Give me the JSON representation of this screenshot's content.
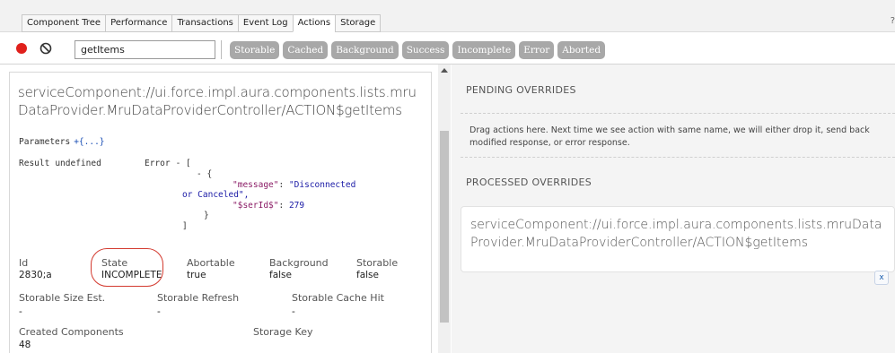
{
  "tabs": [
    {
      "label": "Component Tree"
    },
    {
      "label": "Performance"
    },
    {
      "label": "Transactions"
    },
    {
      "label": "Event Log"
    },
    {
      "label": "Actions"
    },
    {
      "label": "Storage"
    }
  ],
  "active_tab": "Actions",
  "tab_right_mark": "?",
  "toolbar": {
    "record_icon": "record-icon",
    "clear_icon": "clear-icon",
    "filter_value": "getItems",
    "filters": [
      {
        "label": "Storable"
      },
      {
        "label": "Cached"
      },
      {
        "label": "Background"
      },
      {
        "label": "Success"
      },
      {
        "label": "Incomplete"
      },
      {
        "label": "Error"
      },
      {
        "label": "Aborted"
      }
    ]
  },
  "action": {
    "title": "serviceComponent://ui.force.impl.aura.components.lists.mruDataProvider.MruDataProviderController/ACTION$getItems",
    "parameters_label": "Parameters",
    "parameters_value": "+{...}",
    "result_label": "Result",
    "result_value": "undefined",
    "error_label": "Error",
    "error_value": "- [",
    "error_json": {
      "obj_open": "- {",
      "message_key": "\"message\"",
      "message_value_1": "\"Disconnected",
      "message_value_2": "or Canceled\",",
      "serid_key": "\"$serId$\"",
      "serid_value": "279",
      "obj_close": "}",
      "arr_close": "]"
    },
    "fields": {
      "id_label": "Id",
      "id_value": "2830;a",
      "state_label": "State",
      "state_value": "INCOMPLETE",
      "abortable_label": "Abortable",
      "abortable_value": "true",
      "background_label": "Background",
      "background_value": "false",
      "storable_label": "Storable",
      "storable_value": "false",
      "storable_size_label": "Storable Size Est.",
      "storable_size_value": "-",
      "storable_refresh_label": "Storable Refresh",
      "storable_refresh_value": "-",
      "storable_cache_hit_label": "Storable Cache Hit",
      "storable_cache_hit_value": "-",
      "created_components_label": "Created Components",
      "created_components_value": "48",
      "storage_key_label": "Storage Key"
    }
  },
  "overrides": {
    "pending_header": "PENDING OVERRIDES",
    "drop_text": "Drag actions here. Next time we see action with same name, we will either drop it, send back modified response, or error response.",
    "processed_header": "PROCESSED OVERRIDES",
    "processed_item": "serviceComponent://ui.force.impl.aura.components.lists.mruDataProvider.MruDataProviderController/ACTION$getItems",
    "remove_label": "x"
  },
  "colors": {
    "record": "#e0201c",
    "chip_bg": "#a8a8a8",
    "highlight": "#d33a2f"
  }
}
